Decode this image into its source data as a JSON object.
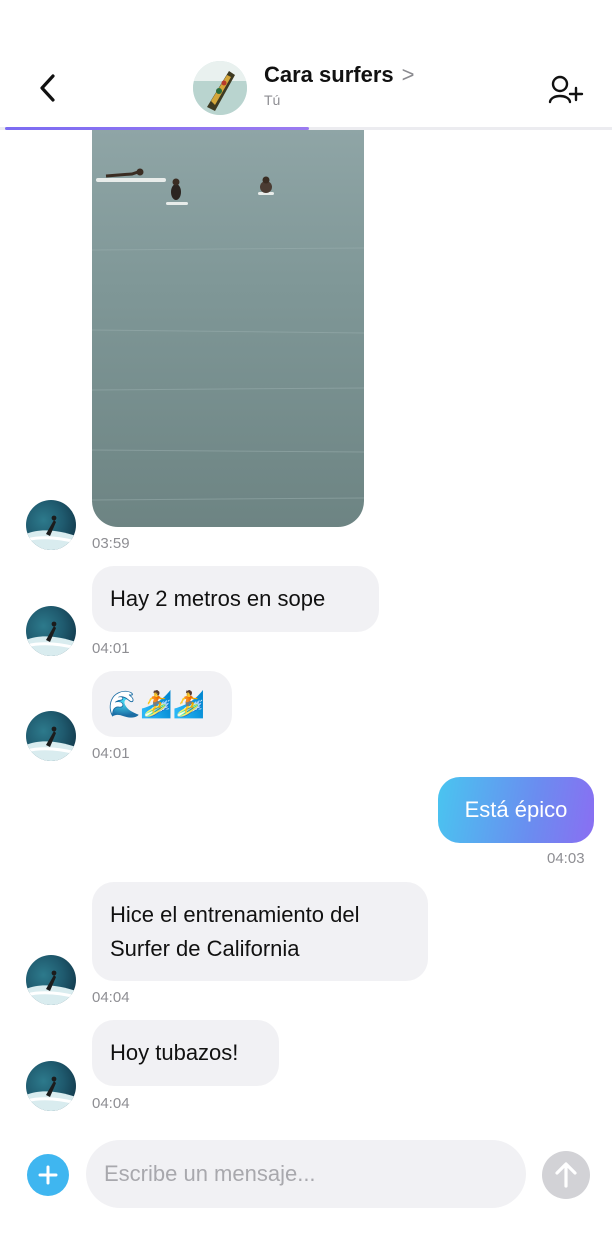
{
  "header": {
    "title": "Cara surfers",
    "title_chevron": ">",
    "subtitle": "Tú",
    "back_icon": "chevron-left-icon",
    "add_user_icon": "add-user-icon"
  },
  "messages": [
    {
      "type": "video",
      "time": "03:59"
    },
    {
      "type": "text",
      "text": "Hay 2 metros en sope",
      "time": "04:01"
    },
    {
      "type": "emoji",
      "text": "🌊🏄🏄",
      "time": "04:01"
    },
    {
      "type": "outgoing",
      "text": "Está épico",
      "time": "04:03"
    },
    {
      "type": "text",
      "line1": "Hice el entrenamiento del",
      "line2": "Surfer de California",
      "time": "04:04"
    },
    {
      "type": "text",
      "text": "Hoy tubazos!",
      "time": "04:04"
    }
  ],
  "composer": {
    "placeholder": "Escribe un mensaje...",
    "value": ""
  },
  "colors": {
    "accent_blue": "#3fb6f0",
    "outgoing_gradient_start": "#49c5f0",
    "outgoing_gradient_end": "#8a6ef2",
    "incoming_bubble": "#f1f1f4",
    "progress": "#7c6cf2"
  }
}
